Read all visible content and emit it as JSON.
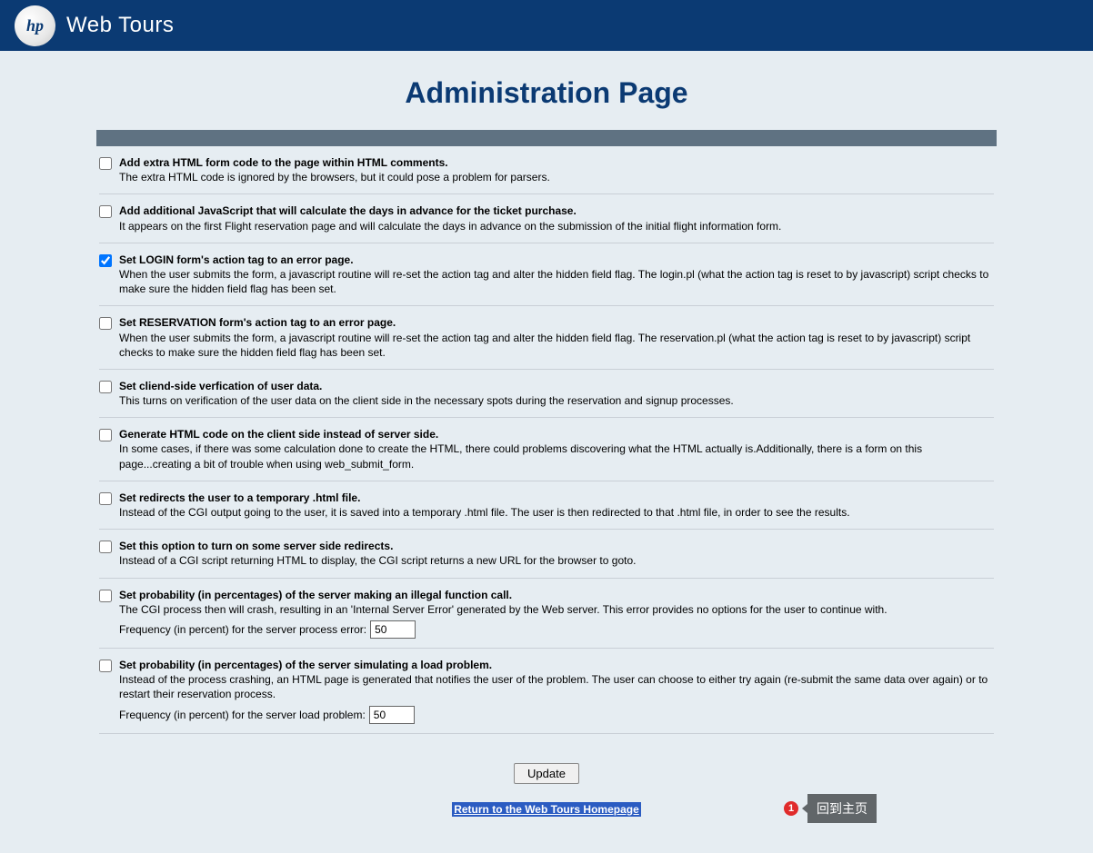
{
  "header": {
    "logo_text": "hp",
    "brand": "Web Tours"
  },
  "page_title": "Administration Page",
  "options": [
    {
      "checked": false,
      "title": "Add extra HTML form code to the page within HTML comments.",
      "desc": "The extra HTML code is ignored by the browsers, but it could pose a problem for parsers."
    },
    {
      "checked": false,
      "title": "Add additional JavaScript that will calculate the days in advance for the ticket purchase.",
      "desc": "It appears on the first Flight reservation page and will calculate the days in advance on the submission of the initial flight information form."
    },
    {
      "checked": true,
      "title": "Set LOGIN form's action tag to an error page.",
      "desc": "When the user submits the form, a javascript routine will re-set the action tag and alter the hidden field flag. The login.pl (what the action tag is reset to by javascript) script checks to make sure the hidden field flag has been set."
    },
    {
      "checked": false,
      "title": "Set RESERVATION form's action tag to an error page.",
      "desc": "When the user submits the form, a javascript routine will re-set the action tag and alter the hidden field flag. The reservation.pl (what the action tag is reset to by javascript) script checks to make sure the hidden field flag has been set."
    },
    {
      "checked": false,
      "title": "Set cliend-side verfication of user data.",
      "desc": "This turns on verification of the user data on the client side in the necessary spots during the reservation and signup processes."
    },
    {
      "checked": false,
      "title": "Generate HTML code on the client side instead of server side.",
      "desc": "In some cases, if there was some calculation done to create the HTML, there could problems discovering what the HTML actually is.Additionally, there is a form on this page...creating a bit of trouble when using web_submit_form."
    },
    {
      "checked": false,
      "title": "Set redirects the user to a temporary .html file.",
      "desc": "Instead of the CGI output going to the user, it is saved into a temporary .html file. The user is then redirected to that .html file, in order to see the results."
    },
    {
      "checked": false,
      "title": "Set this option to turn on some server side redirects.",
      "desc": "Instead of a CGI script returning HTML to display, the CGI script returns a new URL for the browser to goto."
    },
    {
      "checked": false,
      "title": "Set probability (in percentages) of the server making an illegal function call.",
      "desc": "The CGI process then will crash, resulting in an 'Internal Server Error' generated by the Web server. This error provides no options for the user to continue with.",
      "input_label": "Frequency (in percent) for the server process error:",
      "input_value": "50"
    },
    {
      "checked": false,
      "title": "Set probability (in percentages) of the server simulating a load problem.",
      "desc": "Instead of the process crashing, an HTML page is generated that notifies the user of the problem. The user can choose to either try again (re-submit the same data over again) or to restart their reservation process.",
      "input_label": "Frequency (in percent) for the server load problem:",
      "input_value": "50"
    }
  ],
  "footer": {
    "update_button": "Update",
    "return_link": "Return to the Web Tours Homepage"
  },
  "annotation": {
    "num": "1",
    "text": "回到主页"
  }
}
